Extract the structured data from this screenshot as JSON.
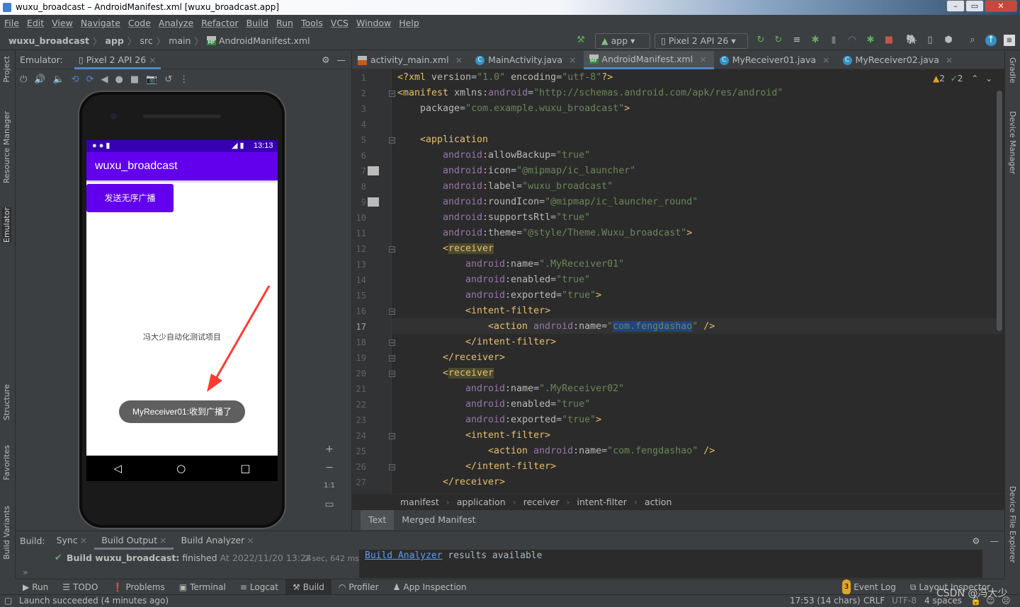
{
  "window": {
    "title": "wuxu_broadcast – AndroidManifest.xml [wuxu_broadcast.app]",
    "minimize": "–",
    "maximize": "▭",
    "close": "✕"
  },
  "menu": [
    "File",
    "Edit",
    "View",
    "Navigate",
    "Code",
    "Analyze",
    "Refactor",
    "Build",
    "Run",
    "Tools",
    "VCS",
    "Window",
    "Help"
  ],
  "nav": {
    "crumbs": [
      "wuxu_broadcast",
      "app",
      "src",
      "main",
      "AndroidManifest.xml"
    ],
    "run_config": "app",
    "device": "Pixel 2 API 26"
  },
  "left_strip": [
    "Project",
    "Resource Manager",
    "Emulator",
    "Structure",
    "Favorites",
    "Build Variants"
  ],
  "right_strip": [
    "Gradle",
    "Device Manager",
    "Device File Explorer"
  ],
  "emulator": {
    "label": "Emulator:",
    "tab": "Pixel 2 API 26",
    "phone": {
      "clock": "13:13",
      "app_title": "wuxu_broadcast",
      "button": "发送无序广播",
      "center_text": "冯大少自动化测试项目",
      "toast": "MyReceiver01:收到广播了",
      "colors": {
        "status": "#3700b3",
        "primary": "#6200ee"
      }
    },
    "zoom": {
      "in": "+",
      "out": "−",
      "actual": "1:1"
    }
  },
  "editor": {
    "tabs": [
      {
        "label": "activity_main.xml",
        "icon": "xml"
      },
      {
        "label": "MainActivity.java",
        "icon": "class"
      },
      {
        "label": "AndroidManifest.xml",
        "icon": "manifest",
        "active": true
      },
      {
        "label": "MyReceiver01.java",
        "icon": "class"
      },
      {
        "label": "MyReceiver02.java",
        "icon": "class"
      }
    ],
    "warnings": "2",
    "weak_warnings": "2",
    "current_line": 17,
    "lines": [
      {
        "i": 0,
        "tokens": [
          [
            "t",
            "<?xml "
          ],
          [
            "a",
            "version"
          ],
          [
            "p",
            "="
          ],
          [
            "s",
            "\"1.0\""
          ],
          [
            "a",
            " encoding"
          ],
          [
            "p",
            "="
          ],
          [
            "s",
            "\"utf-8\""
          ],
          [
            "t",
            "?>"
          ]
        ]
      },
      {
        "i": 0,
        "tokens": [
          [
            "t",
            "<manifest "
          ],
          [
            "a",
            "xmlns:"
          ],
          [
            "n",
            "android"
          ],
          [
            "p",
            "="
          ],
          [
            "s",
            "\"http://schemas.android.com/apk/res/android\""
          ]
        ]
      },
      {
        "i": 1,
        "tokens": [
          [
            "a",
            "package"
          ],
          [
            "p",
            "="
          ],
          [
            "s",
            "\"com.example.wuxu_broadcast\""
          ],
          [
            "t",
            ">"
          ]
        ]
      },
      {
        "i": 0,
        "tokens": []
      },
      {
        "i": 1,
        "tokens": [
          [
            "t",
            "<application"
          ]
        ]
      },
      {
        "i": 2,
        "tokens": [
          [
            "n",
            "android"
          ],
          [
            "a",
            ":allowBackup"
          ],
          [
            "p",
            "="
          ],
          [
            "s",
            "\"true\""
          ]
        ]
      },
      {
        "i": 2,
        "tokens": [
          [
            "n",
            "android"
          ],
          [
            "a",
            ":icon"
          ],
          [
            "p",
            "="
          ],
          [
            "s",
            "\"@mipmap/ic_launcher\""
          ]
        ]
      },
      {
        "i": 2,
        "tokens": [
          [
            "n",
            "android"
          ],
          [
            "a",
            ":label"
          ],
          [
            "p",
            "="
          ],
          [
            "s",
            "\"wuxu_broadcast\""
          ]
        ]
      },
      {
        "i": 2,
        "tokens": [
          [
            "n",
            "android"
          ],
          [
            "a",
            ":roundIcon"
          ],
          [
            "p",
            "="
          ],
          [
            "s",
            "\"@mipmap/ic_launcher_round\""
          ]
        ]
      },
      {
        "i": 2,
        "tokens": [
          [
            "n",
            "android"
          ],
          [
            "a",
            ":supportsRtl"
          ],
          [
            "p",
            "="
          ],
          [
            "s",
            "\"true\""
          ]
        ]
      },
      {
        "i": 2,
        "tokens": [
          [
            "n",
            "android"
          ],
          [
            "a",
            ":theme"
          ],
          [
            "p",
            "="
          ],
          [
            "s",
            "\"@style/Theme.Wuxu_broadcast\""
          ],
          [
            "t",
            ">"
          ]
        ]
      },
      {
        "i": 2,
        "tokens": [
          [
            "t",
            "<"
          ],
          [
            "t hl",
            "receiver"
          ]
        ]
      },
      {
        "i": 3,
        "tokens": [
          [
            "n",
            "android"
          ],
          [
            "a",
            ":name"
          ],
          [
            "p",
            "="
          ],
          [
            "s",
            "\".MyReceiver01\""
          ]
        ]
      },
      {
        "i": 3,
        "tokens": [
          [
            "n",
            "android"
          ],
          [
            "a",
            ":enabled"
          ],
          [
            "p",
            "="
          ],
          [
            "s",
            "\"true\""
          ]
        ]
      },
      {
        "i": 3,
        "tokens": [
          [
            "n",
            "android"
          ],
          [
            "a",
            ":exported"
          ],
          [
            "p",
            "="
          ],
          [
            "s",
            "\"true\""
          ],
          [
            "t",
            ">"
          ]
        ]
      },
      {
        "i": 3,
        "tokens": [
          [
            "t",
            "<intent-filter>"
          ]
        ]
      },
      {
        "i": 4,
        "tokens": [
          [
            "t",
            "<action "
          ],
          [
            "n",
            "android"
          ],
          [
            "a",
            ":name"
          ],
          [
            "p",
            "="
          ],
          [
            "s",
            "\""
          ],
          [
            "s sel",
            "com.fengdashao"
          ],
          [
            "s",
            "\""
          ],
          [
            "t",
            " />"
          ]
        ]
      },
      {
        "i": 3,
        "tokens": [
          [
            "t",
            "</intent-filter>"
          ]
        ]
      },
      {
        "i": 2,
        "tokens": [
          [
            "t",
            "</receiver>"
          ]
        ]
      },
      {
        "i": 2,
        "tokens": [
          [
            "t",
            "<"
          ],
          [
            "t hl",
            "receiver"
          ]
        ]
      },
      {
        "i": 3,
        "tokens": [
          [
            "n",
            "android"
          ],
          [
            "a",
            ":name"
          ],
          [
            "p",
            "="
          ],
          [
            "s",
            "\".MyReceiver02\""
          ]
        ]
      },
      {
        "i": 3,
        "tokens": [
          [
            "n",
            "android"
          ],
          [
            "a",
            ":enabled"
          ],
          [
            "p",
            "="
          ],
          [
            "s",
            "\"true\""
          ]
        ]
      },
      {
        "i": 3,
        "tokens": [
          [
            "n",
            "android"
          ],
          [
            "a",
            ":exported"
          ],
          [
            "p",
            "="
          ],
          [
            "s",
            "\"true\""
          ],
          [
            "t",
            ">"
          ]
        ]
      },
      {
        "i": 3,
        "tokens": [
          [
            "t",
            "<intent-filter>"
          ]
        ]
      },
      {
        "i": 4,
        "tokens": [
          [
            "t",
            "<action "
          ],
          [
            "n",
            "android"
          ],
          [
            "a",
            ":name"
          ],
          [
            "p",
            "="
          ],
          [
            "s",
            "\"com.fengdashao\""
          ],
          [
            "t",
            " />"
          ]
        ]
      },
      {
        "i": 3,
        "tokens": [
          [
            "t",
            "</intent-filter>"
          ]
        ]
      },
      {
        "i": 2,
        "tokens": [
          [
            "t",
            "</receiver>"
          ]
        ]
      }
    ],
    "breadcrumb": [
      "manifest",
      "application",
      "receiver",
      "intent-filter",
      "action"
    ],
    "mode_tabs": [
      "Text",
      "Merged Manifest"
    ]
  },
  "build": {
    "label": "Build:",
    "tabs": [
      "Sync",
      "Build Output",
      "Build Analyzer"
    ],
    "result_bold": "Build wuxu_broadcast:",
    "result": "finished",
    "time": "At 2022/11/20 13:24",
    "duration": "2 sec, 642 ms",
    "console_link": "Build Analyzer",
    "console_text": " results available"
  },
  "tool_windows": [
    "Run",
    "TODO",
    "Problems",
    "Terminal",
    "Logcat",
    "Build",
    "Profiler",
    "App Inspection"
  ],
  "tool_windows_right": {
    "event_log": "Event Log",
    "event_count": "3",
    "layout_inspector": "Layout Inspector"
  },
  "status": {
    "message": "Launch succeeded (4 minutes ago)",
    "position": "17:53 (14 chars)",
    "line_sep": "CRLF",
    "encoding": "UTF-8",
    "indent": "4 spaces",
    "watermark": "CSDN @冯大少"
  },
  "colors": {
    "accent": "#4a88c7",
    "editor_bg": "#2b2b2b",
    "tag": "#e8bf6a",
    "string": "#6a8759",
    "namespace": "#9876aa",
    "arrow": "#ff3b30"
  }
}
